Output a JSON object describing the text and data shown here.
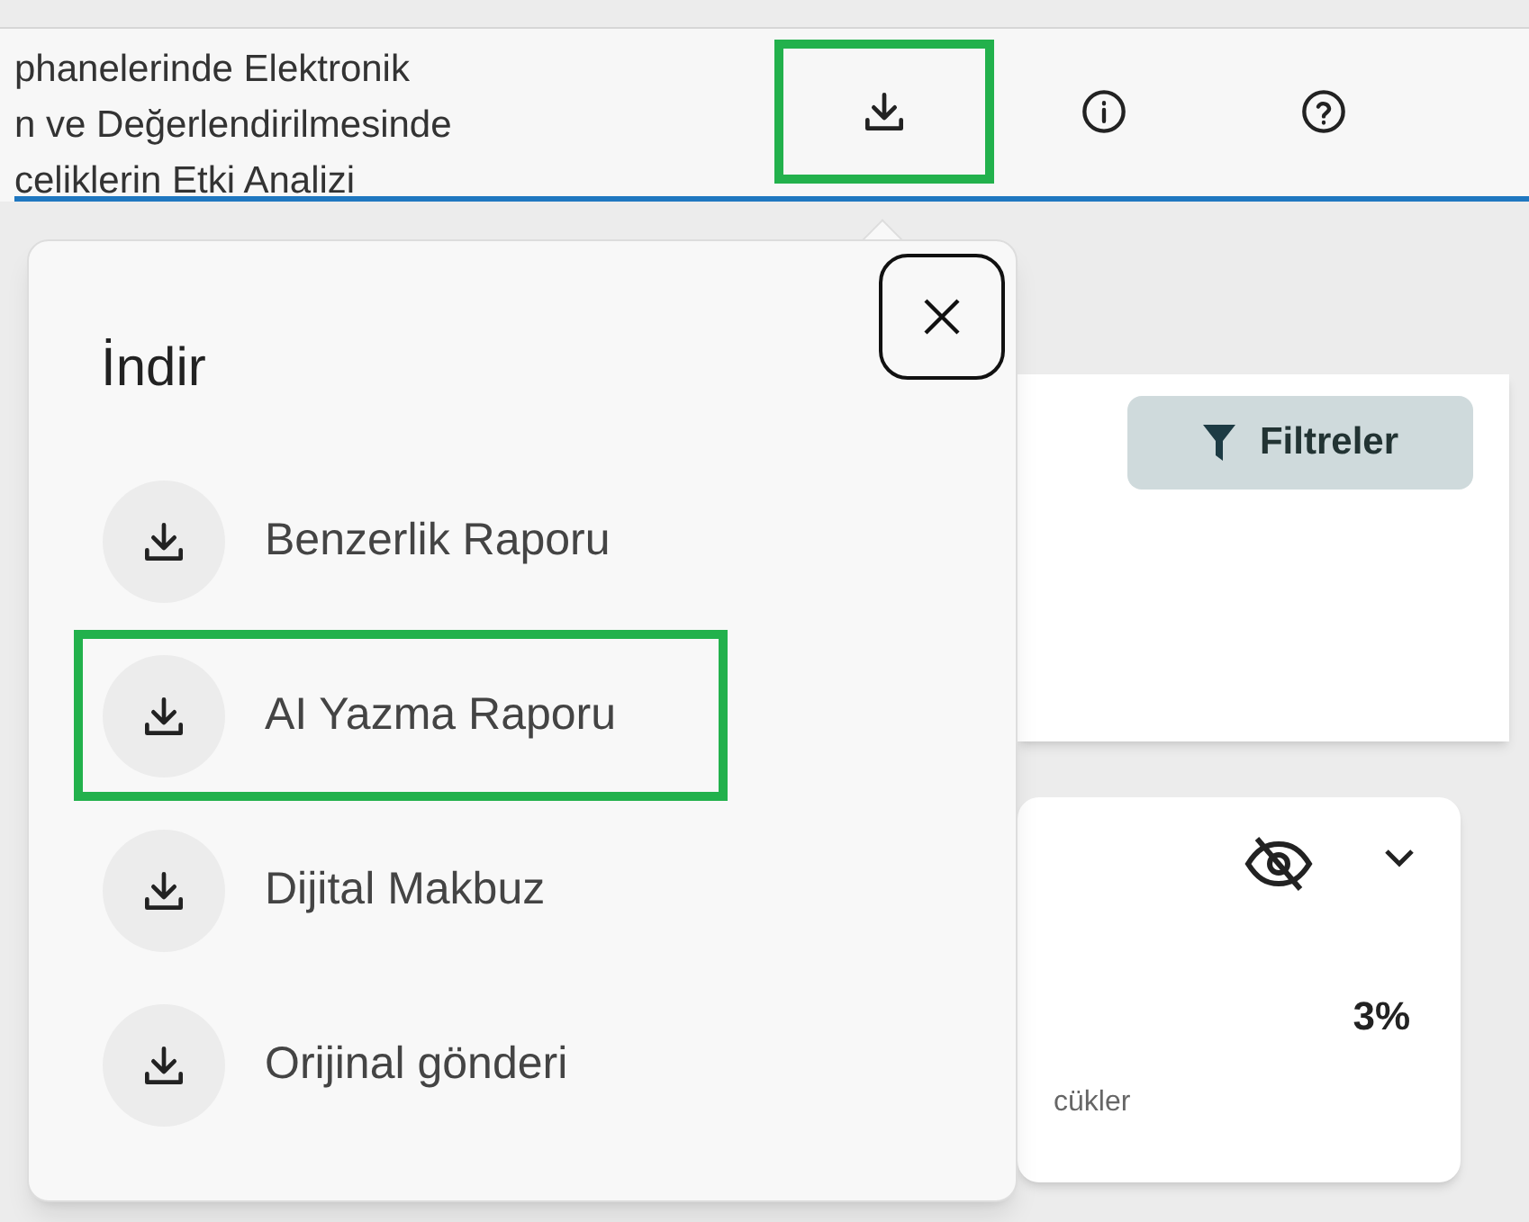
{
  "header": {
    "title_lines": [
      "phanelerinde Elektronik",
      "n ve Değerlendirilmesinde",
      "celiklerin Etki Analizi"
    ],
    "toolbar": [
      {
        "kind": "download",
        "highlighted": true
      },
      {
        "kind": "info",
        "highlighted": false
      },
      {
        "kind": "help",
        "highlighted": false
      }
    ]
  },
  "download_menu": {
    "title": "İndir",
    "items": [
      {
        "label": "Benzerlik Raporu",
        "highlighted": false
      },
      {
        "label": "AI Yazma Raporu",
        "highlighted": true
      },
      {
        "label": "Dijital Makbuz",
        "highlighted": false
      },
      {
        "label": "Orijinal gönderi",
        "highlighted": false
      }
    ]
  },
  "filters_button": {
    "label": "Filtreler"
  },
  "card": {
    "percent": "3%",
    "caption": "cükler"
  }
}
